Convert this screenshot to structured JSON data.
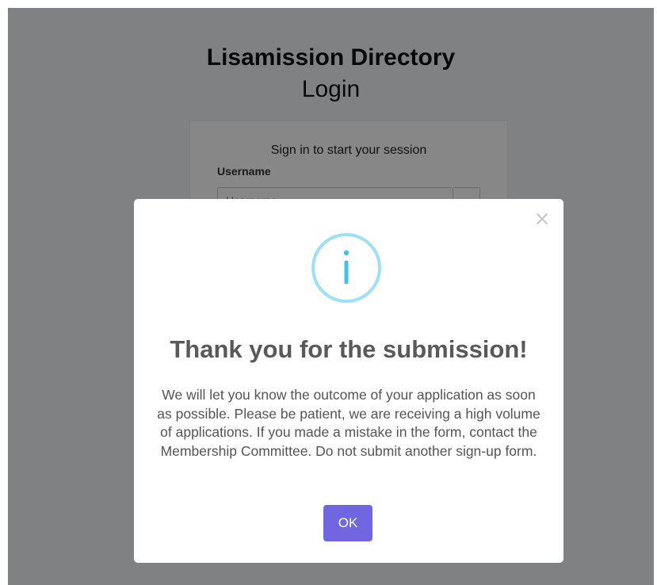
{
  "brand": {
    "title": "Lisamission Directory",
    "subtitle": "Login"
  },
  "login": {
    "message": "Sign in to start your session",
    "username_label": "Username",
    "username_placeholder": "Username"
  },
  "modal": {
    "icon": "info-icon",
    "title": "Thank you for the submission!",
    "text": "We will let you know the outcome of your application as soon as possible. Please be patient, we are receiving a high volume of applications. If you made a mistake in the form, contact the Membership Committee. Do not submit another sign-up form.",
    "ok_label": "OK",
    "close_glyph": "×"
  },
  "colors": {
    "confirm_button": "#7066e0",
    "info_icon": "#3fc3ee",
    "info_icon_ring": "#9de0f6"
  }
}
